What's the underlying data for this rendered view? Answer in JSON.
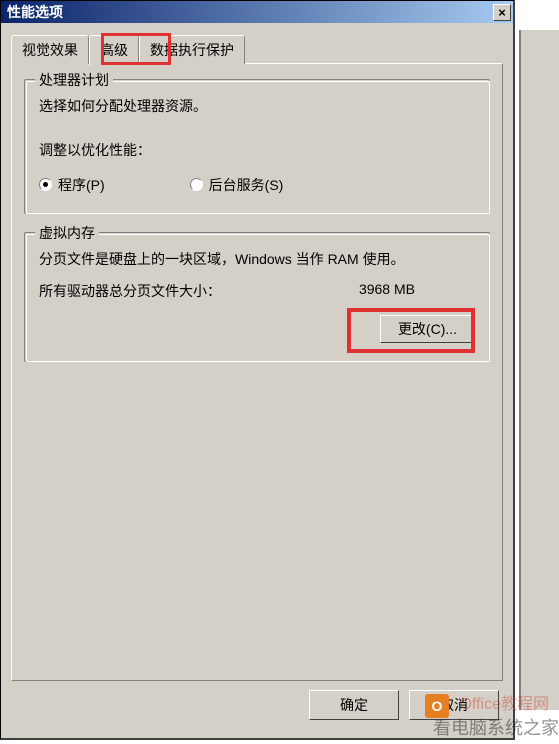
{
  "window": {
    "title": "性能选项",
    "close_label": "×"
  },
  "tabs": [
    {
      "label": "视觉效果"
    },
    {
      "label": "高级"
    },
    {
      "label": "数据执行保护"
    }
  ],
  "processor": {
    "legend": "处理器计划",
    "desc": "选择如何分配处理器资源。",
    "adjust_label": "调整以优化性能：",
    "options": [
      {
        "label": "程序(P)",
        "selected": true
      },
      {
        "label": "后台服务(S)",
        "selected": false
      }
    ]
  },
  "virtual_memory": {
    "legend": "虚拟内存",
    "desc": "分页文件是硬盘上的一块区域，Windows 当作 RAM 使用。",
    "total_label": "所有驱动器总分页文件大小：",
    "total_value": "3968 MB",
    "change_button": "更改(C)..."
  },
  "buttons": {
    "ok": "确定",
    "cancel": "取消"
  },
  "watermarks": {
    "w2": "Office教程网",
    "w3": "看电脑系统之家"
  }
}
